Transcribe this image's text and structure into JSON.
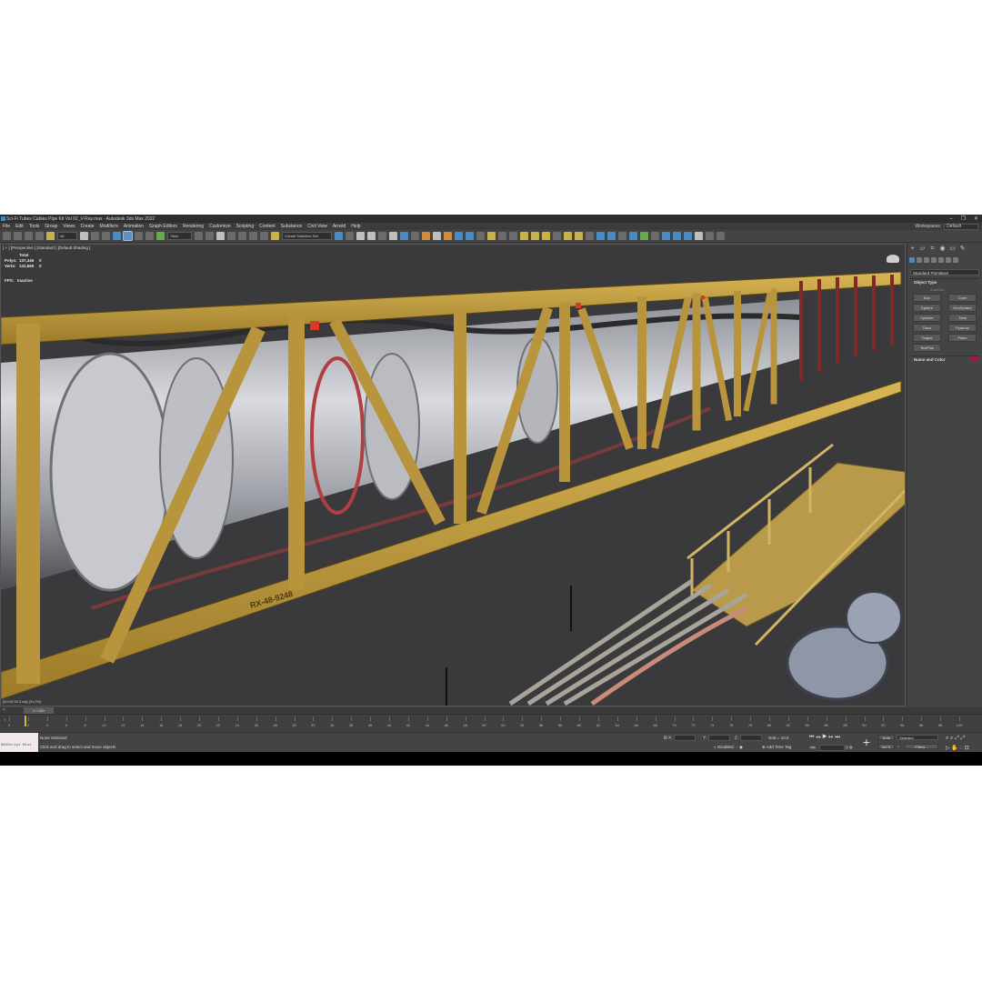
{
  "window": {
    "title": "Sci-Fi Tubes Cables Pipe Kit Vol 02_V-Ray.max - Autodesk 3ds Max 2022",
    "controls": [
      "–",
      "❐",
      "✕"
    ]
  },
  "menu": {
    "items": [
      "File",
      "Edit",
      "Tools",
      "Group",
      "Views",
      "Create",
      "Modifiers",
      "Animation",
      "Graph Editors",
      "Rendering",
      "Customize",
      "Scripting",
      "Content",
      "Substance",
      "Civil View",
      "Arnold",
      "Help"
    ],
    "workspaces_label": "Workspaces:",
    "workspace_value": "Default"
  },
  "toolbar": {
    "filter_value": "All",
    "view_value": "View",
    "selection_set_value": "Create Selection Set"
  },
  "viewport": {
    "label": "[ + ] [Perspective ] [Standard ] [Default Shading ]",
    "stats": {
      "header": "Total",
      "polys_label": "Polys:",
      "polys_total": "137,446",
      "polys_sel": "0",
      "verts_label": "Verts:",
      "verts_total": "142,669",
      "verts_sel": "0",
      "fps_label": "FPS:",
      "fps_value": "Inactive"
    },
    "bottom_text": "[00:00:35.3 mil]  (51.0%)",
    "scene_label": "RX-48-9248"
  },
  "command_panel": {
    "primitive_type": "Standard Primitives",
    "object_type_header": "Object Type",
    "autogrid": "AutoGrid",
    "primitives": [
      "Box",
      "Cone",
      "Sphere",
      "GeoSphere",
      "Cylinder",
      "Tube",
      "Torus",
      "Pyramid",
      "Teapot",
      "Plane",
      "TextPlus"
    ],
    "name_color_header": "Name and Color",
    "object_color": "#9b1d3b"
  },
  "timeline": {
    "frame_indicator": "0 / 100",
    "ticks": [
      "0",
      "2",
      "4",
      "6",
      "8",
      "10",
      "12",
      "14",
      "16",
      "18",
      "20",
      "22",
      "24",
      "26",
      "28",
      "30",
      "32",
      "34",
      "36",
      "38",
      "40",
      "42",
      "44",
      "46",
      "48",
      "50",
      "52",
      "54",
      "56",
      "58",
      "60",
      "62",
      "64",
      "66",
      "68",
      "70",
      "72",
      "74",
      "76",
      "78",
      "80",
      "82",
      "84",
      "86",
      "88",
      "90",
      "92",
      "94",
      "96",
      "98",
      "100"
    ]
  },
  "status": {
    "maxscript": "MAXScript Mini",
    "selection": "None Selected",
    "prompt": "Click and drag to select and move objects",
    "x_label": "X:",
    "y_label": "Y:",
    "z_label": "Z:",
    "grid": "Grid = 10.0",
    "disabled_label": "Disabled:",
    "add_time_tag": "Add Time Tag",
    "auto_label": "Auto",
    "selected_value": "Selected",
    "setk_label": "Set K.",
    "filters_label": "Filters...",
    "frame_value": "0"
  }
}
